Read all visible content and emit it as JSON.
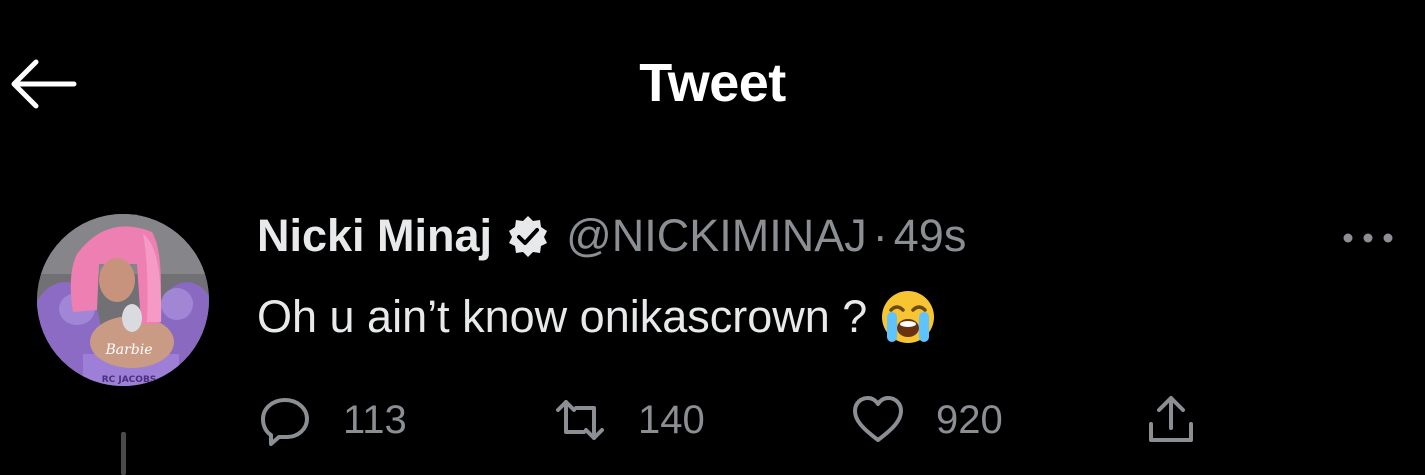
{
  "header": {
    "title": "Tweet"
  },
  "tweet": {
    "display_name": "Nicki Minaj",
    "handle": "@NICKIMINAJ",
    "separator": "·",
    "time": "49s",
    "text": "Oh u ain’t know onikascrown ?",
    "emoji": "loudly-crying-face",
    "avatar_text": {
      "necklace": "Barbie",
      "top": "RC JACOBS"
    }
  },
  "actions": {
    "replies": "113",
    "retweets": "140",
    "likes": "920"
  },
  "colors": {
    "background": "#000000",
    "primary_text": "#e7e9ea",
    "secondary_text": "#8b8f94"
  }
}
